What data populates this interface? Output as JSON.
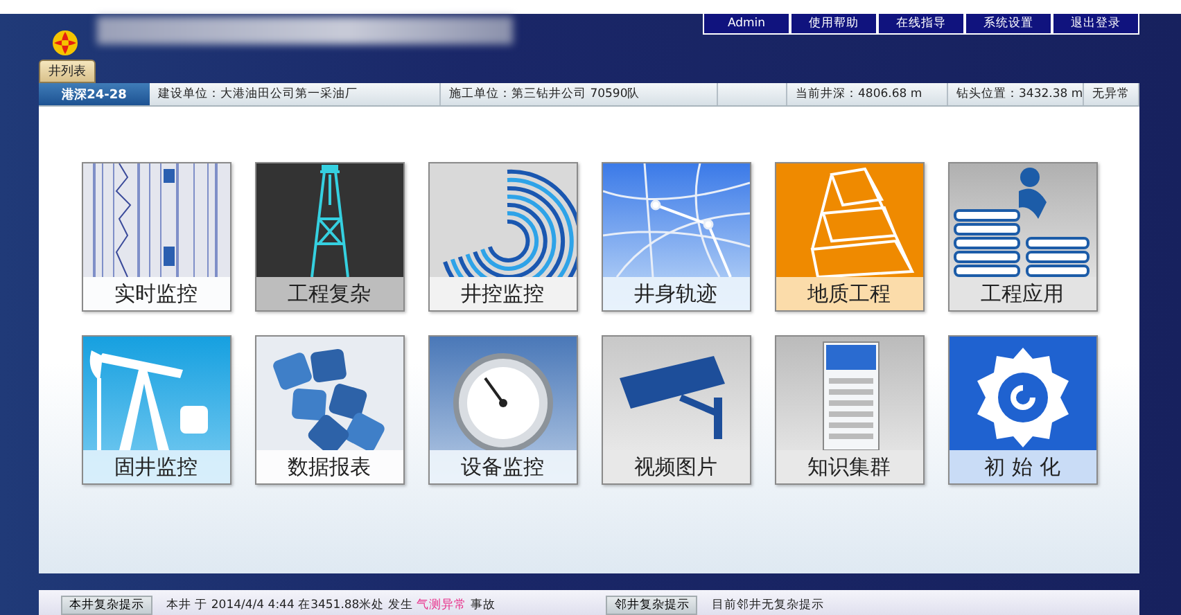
{
  "header": {
    "menu": [
      {
        "label": "Admin"
      },
      {
        "label": "使用帮助"
      },
      {
        "label": "在线指导"
      },
      {
        "label": "系统设置"
      },
      {
        "label": "退出登录"
      }
    ]
  },
  "tab": {
    "label": "井列表",
    "selected": true
  },
  "info_bar": {
    "well": "港深24-28",
    "builder": "建设单位：大港油田公司第一采油厂",
    "contractor": "施工单位：第三钻井公司 70590队",
    "depth": "当前井深：4806.68 m",
    "bit": "钻头位置：3432.38 m",
    "status": "无异常"
  },
  "tiles": [
    {
      "label": "实时监控",
      "kind": "log"
    },
    {
      "label": "工程复杂",
      "kind": "rig"
    },
    {
      "label": "井控监控",
      "kind": "rings"
    },
    {
      "label": "井身轨迹",
      "kind": "map"
    },
    {
      "label": "地质工程",
      "kind": "pyramid"
    },
    {
      "label": "工程应用",
      "kind": "books"
    },
    {
      "label": "固井监控",
      "kind": "pumpjack"
    },
    {
      "label": "数据报表",
      "kind": "puzzle"
    },
    {
      "label": "设备监控",
      "kind": "gauge"
    },
    {
      "label": "视频图片",
      "kind": "camera"
    },
    {
      "label": "知识集群",
      "kind": "server"
    },
    {
      "label": "初 始 化",
      "kind": "gear"
    }
  ],
  "footer": {
    "own_button": "本井复杂提示",
    "own_message": "本井 于 2014/4/4 4:44 在3451.88米处 发生 **气测异常** 事故",
    "neighbor_button": "邻井复杂提示",
    "neighbor_message": "目前邻井无复杂提示"
  }
}
